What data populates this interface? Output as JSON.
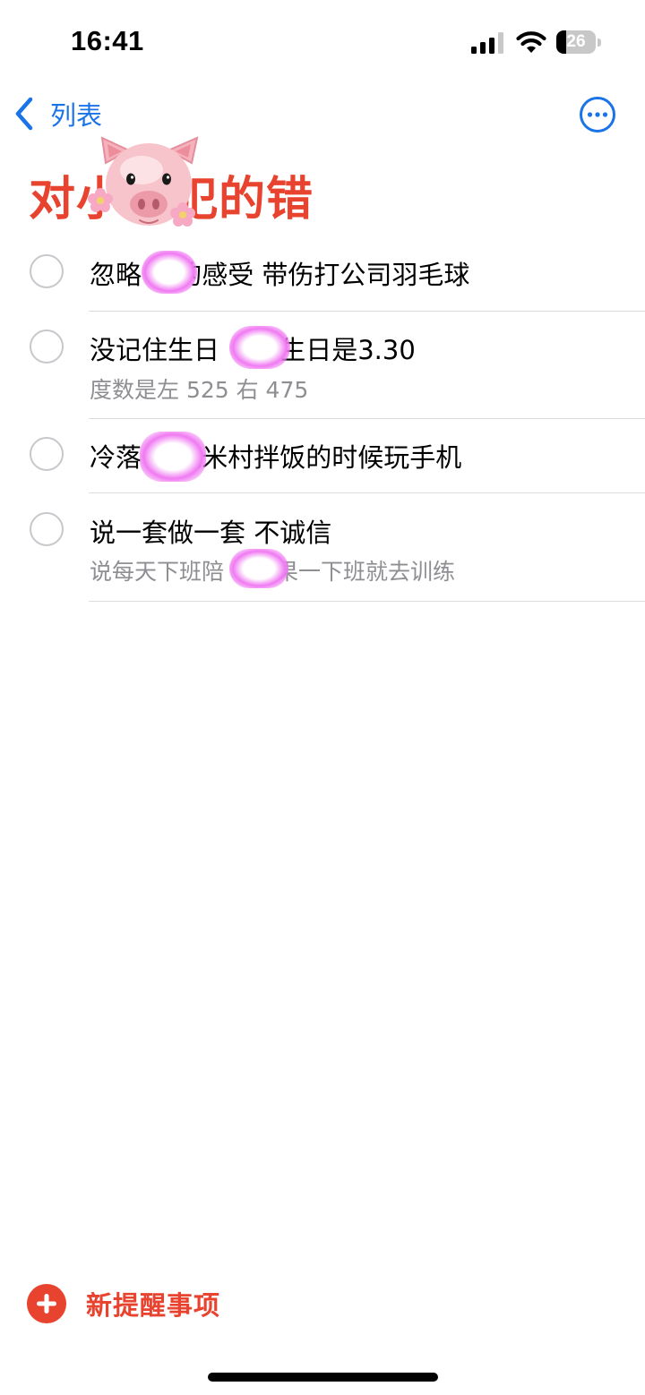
{
  "status_bar": {
    "time": "16:41",
    "battery_level": "26",
    "battery_fraction": 0.26
  },
  "nav": {
    "back_label": "列表",
    "back_icon": "chevron-left-icon",
    "more_icon": "ellipsis-circle-icon"
  },
  "list": {
    "title": "对小猪犯的错",
    "sticker": "pig-face-sticker"
  },
  "reminders": [
    {
      "title": "忽略　 的感受 带伤打公司羽毛球",
      "note": ""
    },
    {
      "title": "没记住生日　 的生日是3.30",
      "note": "度数是左 525 右 475"
    },
    {
      "title": "冷落　 吃米村拌饭的时候玩手机",
      "note": ""
    },
    {
      "title": "说一套做一套 不诚信",
      "note": "说每天下班陪　 结果一下班就去训练"
    }
  ],
  "footer": {
    "new_reminder_label": "新提醒事项",
    "new_reminder_icon": "plus-circle-icon"
  },
  "colors": {
    "accent_red": "#e8432e",
    "accent_blue": "#1a74e8",
    "redaction_pink": "#f07af2"
  }
}
